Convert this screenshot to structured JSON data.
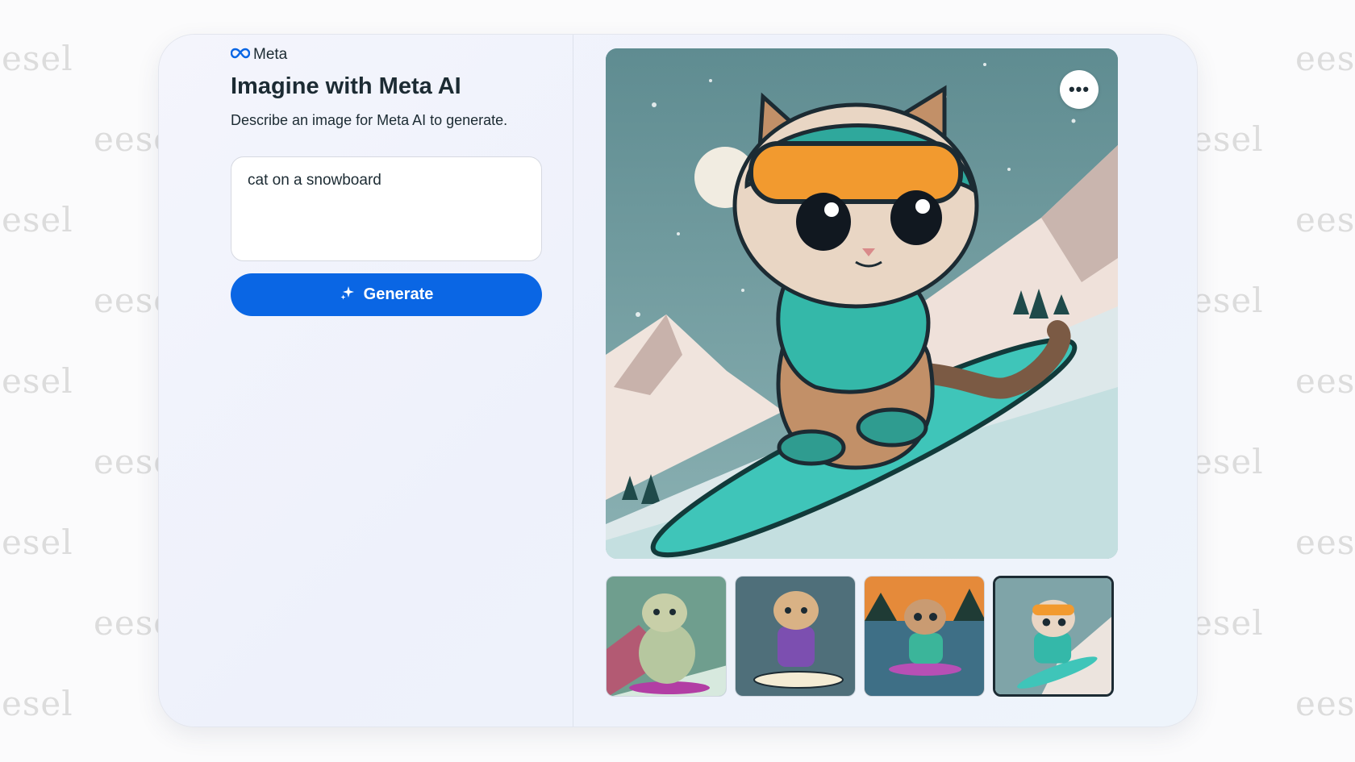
{
  "watermark": {
    "text": "eesel",
    "partial_text": "esel"
  },
  "brand": {
    "name": "Meta",
    "logo_icon": "meta-infinity-icon",
    "color": "#0a66e4"
  },
  "header": {
    "title": "Imagine with Meta AI",
    "subtitle": "Describe an image for Meta AI to generate."
  },
  "prompt": {
    "value": "cat on a snowboard",
    "placeholder": ""
  },
  "generate_button": {
    "label": "Generate",
    "icon": "sparkle-icon",
    "color": "#0a66e4"
  },
  "preview": {
    "more_options_icon": "more-horizontal-icon",
    "selected_index": 3,
    "thumbnails": [
      {
        "name": "thumbnail-1"
      },
      {
        "name": "thumbnail-2"
      },
      {
        "name": "thumbnail-3"
      },
      {
        "name": "thumbnail-4"
      }
    ]
  }
}
